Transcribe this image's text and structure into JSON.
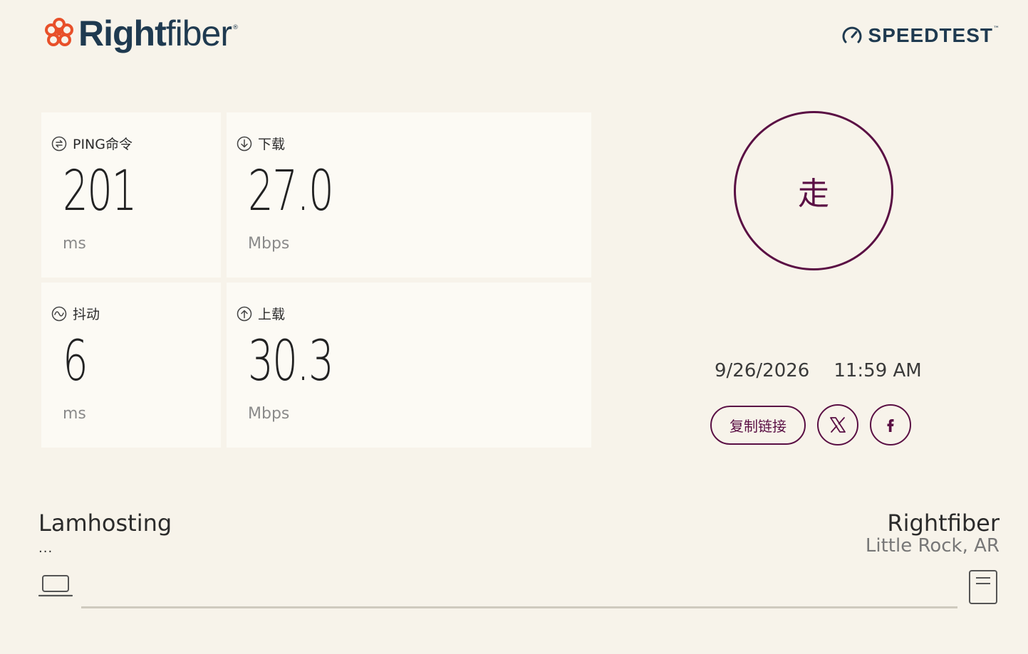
{
  "brand": {
    "name_bold": "Right",
    "name_light": "fiber",
    "reg_mark": "®"
  },
  "speedtest": {
    "label": "SPEEDTEST",
    "tm": "™"
  },
  "metrics": {
    "ping": {
      "label": "PING命令",
      "value": "201",
      "unit": "ms"
    },
    "download": {
      "label": "下载",
      "value": "27.0",
      "unit": "Mbps"
    },
    "jitter": {
      "label": "抖动",
      "value": "6",
      "unit": "ms"
    },
    "upload": {
      "label": "上载",
      "value": "30.3",
      "unit": "Mbps"
    }
  },
  "go_button": {
    "label": "走"
  },
  "result": {
    "date": "9/26/2026",
    "time": "11:59 AM"
  },
  "share": {
    "copy_link": "复制链接"
  },
  "client": {
    "isp": "Lamhosting",
    "ip": "..."
  },
  "server": {
    "name": "Rightfiber",
    "location": "Little Rock, AR"
  },
  "colors": {
    "accent": "#5a0f44",
    "brand_navy": "#1f3a50",
    "brand_orange": "#e8502a",
    "background": "#f7f3ea"
  }
}
